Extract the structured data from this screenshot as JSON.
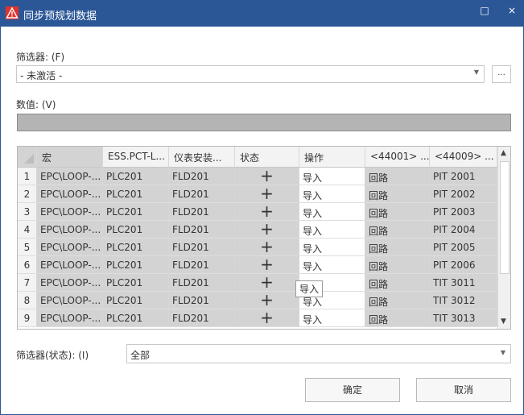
{
  "window": {
    "title": "同步预规划数据",
    "maximize": "□",
    "close": "×"
  },
  "filter": {
    "label": "筛选器: (F)",
    "value": "- 未激活 -",
    "more": "..."
  },
  "values": {
    "label": "数值: (V)"
  },
  "grid": {
    "headers": [
      "宏",
      "ESS.PCT-L...",
      "仪表安装...",
      "状态",
      "操作",
      "<44001> ...",
      "<44009> ..."
    ],
    "rows": [
      {
        "num": "1",
        "macro": "EPC\\LOOP-...",
        "plc": "PLC201",
        "fld": "FLD201",
        "op": "导入",
        "type": "回路",
        "tag": "PIT 2001"
      },
      {
        "num": "2",
        "macro": "EPC\\LOOP-...",
        "plc": "PLC201",
        "fld": "FLD201",
        "op": "导入",
        "type": "回路",
        "tag": "PIT 2002"
      },
      {
        "num": "3",
        "macro": "EPC\\LOOP-...",
        "plc": "PLC201",
        "fld": "FLD201",
        "op": "导入",
        "type": "回路",
        "tag": "PIT 2003"
      },
      {
        "num": "4",
        "macro": "EPC\\LOOP-...",
        "plc": "PLC201",
        "fld": "FLD201",
        "op": "导入",
        "type": "回路",
        "tag": "PIT 2004"
      },
      {
        "num": "5",
        "macro": "EPC\\LOOP-...",
        "plc": "PLC201",
        "fld": "FLD201",
        "op": "导入",
        "type": "回路",
        "tag": "PIT 2005"
      },
      {
        "num": "6",
        "macro": "EPC\\LOOP-...",
        "plc": "PLC201",
        "fld": "FLD201",
        "op": "导入",
        "type": "回路",
        "tag": "PIT 2006"
      },
      {
        "num": "7",
        "macro": "EPC\\LOOP-...",
        "plc": "PLC201",
        "fld": "FLD201",
        "op": "",
        "type": "回路",
        "tag": "TIT 3011"
      },
      {
        "num": "8",
        "macro": "EPC\\LOOP-...",
        "plc": "PLC201",
        "fld": "FLD201",
        "op": "导入",
        "type": "回路",
        "tag": "TIT 3012"
      },
      {
        "num": "9",
        "macro": "EPC\\LOOP-...",
        "plc": "PLC201",
        "fld": "FLD201",
        "op": "导入",
        "type": "回路",
        "tag": "TIT 3013"
      }
    ],
    "status_glyph": "+",
    "tooltip": "导入"
  },
  "status_filter": {
    "label": "筛选器(状态): (I)",
    "value": "全部"
  },
  "buttons": {
    "ok": "确定",
    "cancel": "取消"
  },
  "colors": {
    "title_bar": "#2b5797",
    "warning_icon": "#e0322e",
    "selected_cell": "#d3d3d3"
  }
}
